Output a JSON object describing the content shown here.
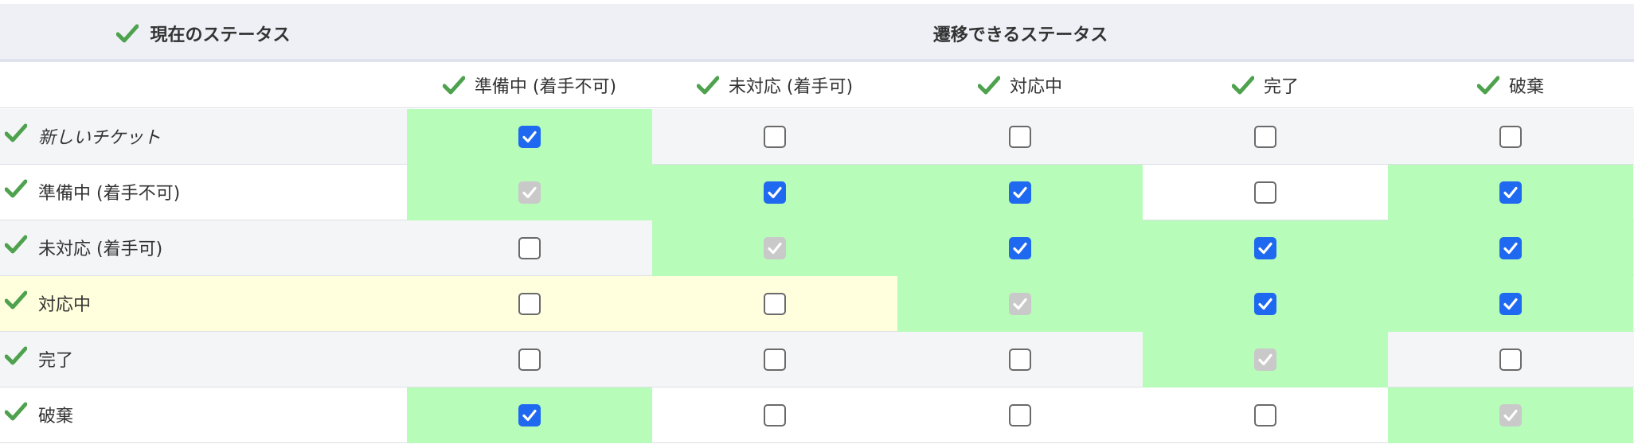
{
  "header": {
    "current_status": "現在のステータス",
    "transition_status": "遷移できるステータス"
  },
  "columns": [
    "準備中 (着手不可)",
    "未対応 (着手可)",
    "対応中",
    "完了",
    "破棄"
  ],
  "rows": [
    {
      "label": "新しいチケット",
      "italic": true,
      "bg": "#f4f5f7",
      "states": [
        "checked",
        "unchecked",
        "unchecked",
        "unchecked",
        "unchecked"
      ],
      "green": [
        true,
        false,
        false,
        false,
        false
      ]
    },
    {
      "label": "準備中 (着手不可)",
      "italic": false,
      "bg": "#ffffff",
      "states": [
        "disabled",
        "checked",
        "checked",
        "unchecked",
        "checked"
      ],
      "green": [
        true,
        true,
        true,
        false,
        true
      ]
    },
    {
      "label": "未対応 (着手可)",
      "italic": false,
      "bg": "#f4f5f7",
      "states": [
        "unchecked",
        "disabled",
        "checked",
        "checked",
        "checked"
      ],
      "green": [
        false,
        true,
        true,
        true,
        true
      ]
    },
    {
      "label": "対応中",
      "italic": false,
      "bg": "#ffffdd",
      "states": [
        "unchecked",
        "unchecked",
        "disabled",
        "checked",
        "checked"
      ],
      "green": [
        false,
        false,
        true,
        true,
        true
      ]
    },
    {
      "label": "完了",
      "italic": false,
      "bg": "#f4f5f7",
      "states": [
        "unchecked",
        "unchecked",
        "unchecked",
        "disabled",
        "unchecked"
      ],
      "green": [
        false,
        false,
        false,
        true,
        false
      ]
    },
    {
      "label": "破棄",
      "italic": false,
      "bg": "#ffffff",
      "states": [
        "checked",
        "unchecked",
        "unchecked",
        "unchecked",
        "disabled"
      ],
      "green": [
        true,
        false,
        false,
        false,
        true
      ]
    }
  ],
  "colors": {
    "allowed_cell": "#b7fcb9",
    "current_row_highlight": "#ffffdd",
    "checkbox_checked": "#1f69f0",
    "checkbox_disabled": "#c9c9c9",
    "check_icon": "#4ea24e"
  },
  "icons": {
    "status_mark": "check-icon"
  }
}
